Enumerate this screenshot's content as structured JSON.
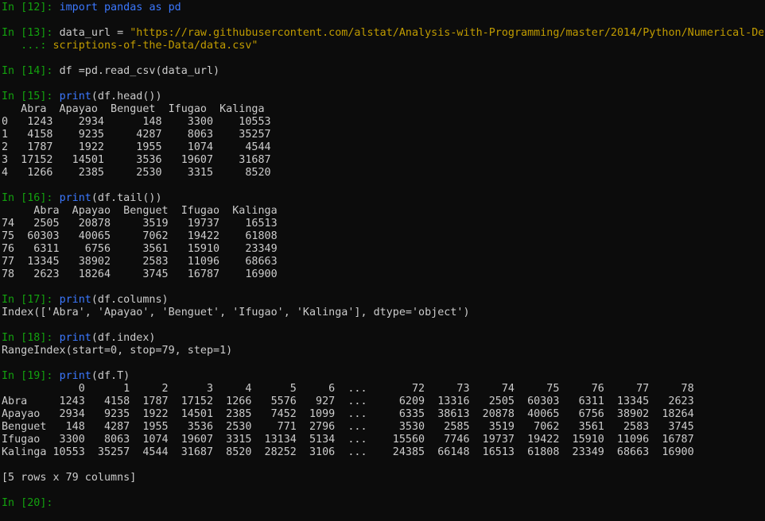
{
  "terminal": {
    "cells": {
      "p12": "In [12]: ",
      "in12_import": "import",
      "in12_pandas": " pandas ",
      "in12_as": "as",
      "in12_pd": " pd",
      "p13": "In [13]: ",
      "in13_a": "data_url = ",
      "in13_b": "\"https://raw.githubusercontent.com/alstat/Analysis-with-Programming/master/2014/Python/Numerical-De",
      "p13c": "   ...: ",
      "in13_c": "scriptions-of-the-Data/data.csv\"",
      "p14": "In [14]: ",
      "in14": "df =pd.read_csv(data_url)",
      "p15": "In [15]: ",
      "in15_print": "print",
      "in15_rest": "(df.head())",
      "out15": [
        "   Abra  Apayao  Benguet  Ifugao  Kalinga",
        "0   1243    2934      148    3300    10553",
        "1   4158    9235     4287    8063    35257",
        "2   1787    1922     1955    1074     4544",
        "3  17152   14501     3536   19607    31687",
        "4   1266    2385     2530    3315     8520"
      ],
      "p16": "In [16]: ",
      "in16_print": "print",
      "in16_rest": "(df.tail())",
      "out16": [
        "     Abra  Apayao  Benguet  Ifugao  Kalinga",
        "74   2505   20878     3519   19737    16513",
        "75  60303   40065     7062   19422    61808",
        "76   6311    6756     3561   15910    23349",
        "77  13345   38902     2583   11096    68663",
        "78   2623   18264     3745   16787    16900"
      ],
      "p17": "In [17]: ",
      "in17_print": "print",
      "in17_rest": "(df.columns)",
      "out17": "Index(['Abra', 'Apayao', 'Benguet', 'Ifugao', 'Kalinga'], dtype='object')",
      "p18": "In [18]: ",
      "in18_print": "print",
      "in18_rest": "(df.index)",
      "out18": "RangeIndex(start=0, stop=79, step=1)",
      "p19": "In [19]: ",
      "in19_print": "print",
      "in19_rest": "(df.T)",
      "out19": [
        "            0      1     2      3     4      5     6  ...       72     73     74     75     76     77     78",
        "Abra     1243   4158  1787  17152  1266   5576   927  ...     6209  13316   2505  60303   6311  13345   2623",
        "Apayao   2934   9235  1922  14501  2385   7452  1099  ...     6335  38613  20878  40065   6756  38902  18264",
        "Benguet   148   4287  1955   3536  2530    771  2796  ...     3530   2585   3519   7062   3561   2583   3745",
        "Ifugao   3300   8063  1074  19607  3315  13134  5134  ...    15560   7746  19737  19422  15910  11096  16787",
        "Kalinga 10553  35257  4544  31687  8520  28252  3106  ...    24385  66148  16513  61808  23349  68663  16900"
      ],
      "out19_summary": "[5 rows x 79 columns]",
      "p20": "In [20]: "
    }
  }
}
